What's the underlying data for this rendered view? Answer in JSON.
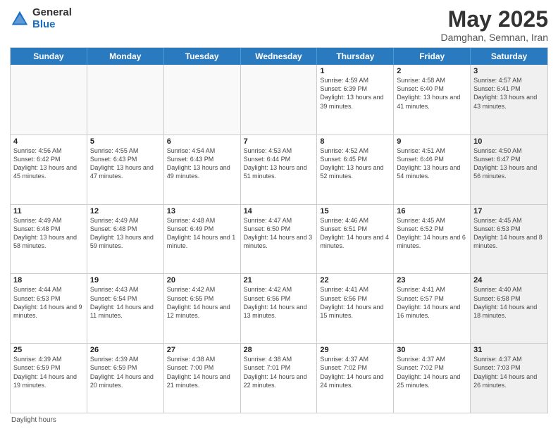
{
  "logo": {
    "general": "General",
    "blue": "Blue"
  },
  "title": "May 2025",
  "subtitle": "Damghan, Semnan, Iran",
  "days_header": [
    "Sunday",
    "Monday",
    "Tuesday",
    "Wednesday",
    "Thursday",
    "Friday",
    "Saturday"
  ],
  "footer": "Daylight hours",
  "weeks": [
    [
      {
        "day": "",
        "info": "",
        "empty": true
      },
      {
        "day": "",
        "info": "",
        "empty": true
      },
      {
        "day": "",
        "info": "",
        "empty": true
      },
      {
        "day": "",
        "info": "",
        "empty": true
      },
      {
        "day": "1",
        "info": "Sunrise: 4:59 AM\nSunset: 6:39 PM\nDaylight: 13 hours\nand 39 minutes."
      },
      {
        "day": "2",
        "info": "Sunrise: 4:58 AM\nSunset: 6:40 PM\nDaylight: 13 hours\nand 41 minutes."
      },
      {
        "day": "3",
        "info": "Sunrise: 4:57 AM\nSunset: 6:41 PM\nDaylight: 13 hours\nand 43 minutes.",
        "shaded": true
      }
    ],
    [
      {
        "day": "4",
        "info": "Sunrise: 4:56 AM\nSunset: 6:42 PM\nDaylight: 13 hours\nand 45 minutes."
      },
      {
        "day": "5",
        "info": "Sunrise: 4:55 AM\nSunset: 6:43 PM\nDaylight: 13 hours\nand 47 minutes."
      },
      {
        "day": "6",
        "info": "Sunrise: 4:54 AM\nSunset: 6:43 PM\nDaylight: 13 hours\nand 49 minutes."
      },
      {
        "day": "7",
        "info": "Sunrise: 4:53 AM\nSunset: 6:44 PM\nDaylight: 13 hours\nand 51 minutes."
      },
      {
        "day": "8",
        "info": "Sunrise: 4:52 AM\nSunset: 6:45 PM\nDaylight: 13 hours\nand 52 minutes."
      },
      {
        "day": "9",
        "info": "Sunrise: 4:51 AM\nSunset: 6:46 PM\nDaylight: 13 hours\nand 54 minutes."
      },
      {
        "day": "10",
        "info": "Sunrise: 4:50 AM\nSunset: 6:47 PM\nDaylight: 13 hours\nand 56 minutes.",
        "shaded": true
      }
    ],
    [
      {
        "day": "11",
        "info": "Sunrise: 4:49 AM\nSunset: 6:48 PM\nDaylight: 13 hours\nand 58 minutes."
      },
      {
        "day": "12",
        "info": "Sunrise: 4:49 AM\nSunset: 6:48 PM\nDaylight: 13 hours\nand 59 minutes."
      },
      {
        "day": "13",
        "info": "Sunrise: 4:48 AM\nSunset: 6:49 PM\nDaylight: 14 hours\nand 1 minute."
      },
      {
        "day": "14",
        "info": "Sunrise: 4:47 AM\nSunset: 6:50 PM\nDaylight: 14 hours\nand 3 minutes."
      },
      {
        "day": "15",
        "info": "Sunrise: 4:46 AM\nSunset: 6:51 PM\nDaylight: 14 hours\nand 4 minutes."
      },
      {
        "day": "16",
        "info": "Sunrise: 4:45 AM\nSunset: 6:52 PM\nDaylight: 14 hours\nand 6 minutes."
      },
      {
        "day": "17",
        "info": "Sunrise: 4:45 AM\nSunset: 6:53 PM\nDaylight: 14 hours\nand 8 minutes.",
        "shaded": true
      }
    ],
    [
      {
        "day": "18",
        "info": "Sunrise: 4:44 AM\nSunset: 6:53 PM\nDaylight: 14 hours\nand 9 minutes."
      },
      {
        "day": "19",
        "info": "Sunrise: 4:43 AM\nSunset: 6:54 PM\nDaylight: 14 hours\nand 11 minutes."
      },
      {
        "day": "20",
        "info": "Sunrise: 4:42 AM\nSunset: 6:55 PM\nDaylight: 14 hours\nand 12 minutes."
      },
      {
        "day": "21",
        "info": "Sunrise: 4:42 AM\nSunset: 6:56 PM\nDaylight: 14 hours\nand 13 minutes."
      },
      {
        "day": "22",
        "info": "Sunrise: 4:41 AM\nSunset: 6:56 PM\nDaylight: 14 hours\nand 15 minutes."
      },
      {
        "day": "23",
        "info": "Sunrise: 4:41 AM\nSunset: 6:57 PM\nDaylight: 14 hours\nand 16 minutes."
      },
      {
        "day": "24",
        "info": "Sunrise: 4:40 AM\nSunset: 6:58 PM\nDaylight: 14 hours\nand 18 minutes.",
        "shaded": true
      }
    ],
    [
      {
        "day": "25",
        "info": "Sunrise: 4:39 AM\nSunset: 6:59 PM\nDaylight: 14 hours\nand 19 minutes."
      },
      {
        "day": "26",
        "info": "Sunrise: 4:39 AM\nSunset: 6:59 PM\nDaylight: 14 hours\nand 20 minutes."
      },
      {
        "day": "27",
        "info": "Sunrise: 4:38 AM\nSunset: 7:00 PM\nDaylight: 14 hours\nand 21 minutes."
      },
      {
        "day": "28",
        "info": "Sunrise: 4:38 AM\nSunset: 7:01 PM\nDaylight: 14 hours\nand 22 minutes."
      },
      {
        "day": "29",
        "info": "Sunrise: 4:37 AM\nSunset: 7:02 PM\nDaylight: 14 hours\nand 24 minutes."
      },
      {
        "day": "30",
        "info": "Sunrise: 4:37 AM\nSunset: 7:02 PM\nDaylight: 14 hours\nand 25 minutes."
      },
      {
        "day": "31",
        "info": "Sunrise: 4:37 AM\nSunset: 7:03 PM\nDaylight: 14 hours\nand 26 minutes.",
        "shaded": true
      }
    ]
  ]
}
